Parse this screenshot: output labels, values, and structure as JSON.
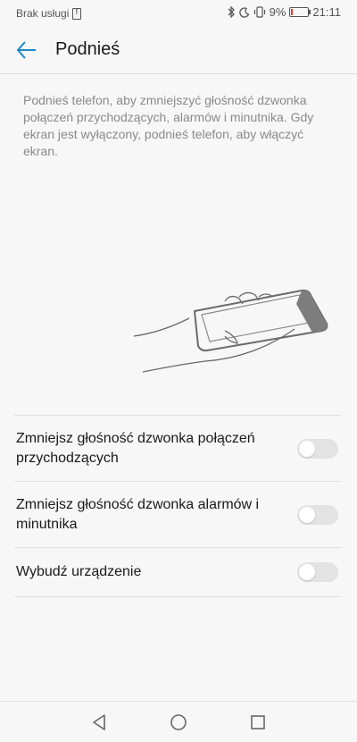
{
  "status_bar": {
    "carrier": "Brak usługi",
    "battery_percent": "9%",
    "battery_level": 0.09,
    "time": "21:11",
    "icons": [
      "sim-icon",
      "bluetooth-icon",
      "do-not-disturb-moon-icon",
      "vibrate-icon",
      "battery-icon"
    ]
  },
  "header": {
    "title": "Podnieś",
    "back_icon": "arrow-left-icon"
  },
  "description": "Podnieś telefon, aby zmniejszyć głośność dzwonka połączeń przychodzących, alarmów i minutnika. Gdy ekran jest wyłączony, podnieś telefon, aby włączyć ekran.",
  "illustration": {
    "icon": "hand-holding-phone-illustration"
  },
  "settings": {
    "items": [
      {
        "label": "Zmniejsz głośność dzwonka połączeń przychodzących",
        "enabled": false
      },
      {
        "label": "Zmniejsz głośność dzwonka alarmów i minutnika",
        "enabled": false
      },
      {
        "label": "Wybudź urządzenie",
        "enabled": false
      }
    ]
  },
  "nav_bar": {
    "icons": [
      "back-triangle-icon",
      "home-circle-icon",
      "recents-square-icon"
    ]
  },
  "colors": {
    "accent": "#1e88c8",
    "background": "#f7f7f7",
    "toggle_off": "#e3e3e3",
    "battery_low": "#e53935"
  }
}
